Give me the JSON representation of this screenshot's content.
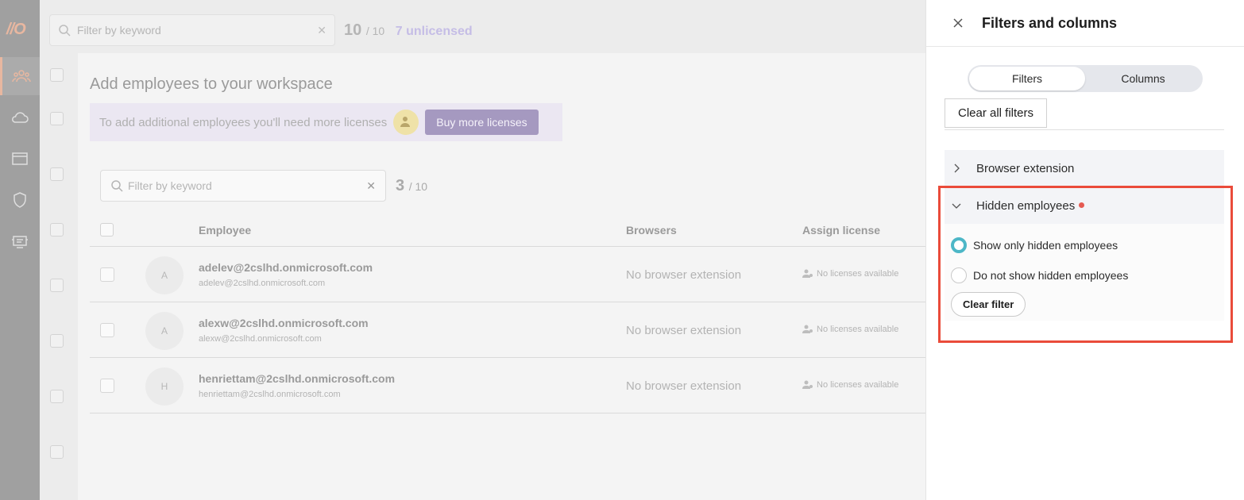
{
  "app": {
    "logo": "//O"
  },
  "nav": [
    {
      "name": "employees-icon",
      "active": true
    },
    {
      "name": "cloud-icon",
      "active": false
    },
    {
      "name": "browser-window-icon",
      "active": false
    },
    {
      "name": "shield-icon",
      "active": false
    },
    {
      "name": "device-icon",
      "active": false
    }
  ],
  "top": {
    "search_placeholder": "Filter by keyword",
    "count": "10",
    "total": "/ 10",
    "unlicensed": "7 unlicensed"
  },
  "modal": {
    "title": "Add employees to your workspace",
    "notice": "To add additional employees you'll need more licenses",
    "buy_label": "Buy more licenses",
    "search_placeholder": "Filter by keyword",
    "count": "3",
    "total": "/ 10",
    "columns": {
      "employee": "Employee",
      "browsers": "Browsers",
      "assign": "Assign license"
    },
    "rows": [
      {
        "initial": "A",
        "email": "adelev@2cslhd.onmicrosoft.com",
        "email_sub": "adelev@2cslhd.onmicrosoft.com",
        "browser": "No browser extension",
        "license": "No licenses available"
      },
      {
        "initial": "A",
        "email": "alexw@2cslhd.onmicrosoft.com",
        "email_sub": "alexw@2cslhd.onmicrosoft.com",
        "browser": "No browser extension",
        "license": "No licenses available"
      },
      {
        "initial": "H",
        "email": "henriettam@2cslhd.onmicrosoft.com",
        "email_sub": "henriettam@2cslhd.onmicrosoft.com",
        "browser": "No browser extension",
        "license": "No licenses available"
      }
    ]
  },
  "drawer": {
    "title": "Filters and columns",
    "tabs": {
      "filters": "Filters",
      "columns": "Columns",
      "active": "Filters"
    },
    "clear_all": "Clear all filters",
    "sections": {
      "browser_extension": {
        "label": "Browser extension",
        "expanded": false
      },
      "hidden_employees": {
        "label": "Hidden employees",
        "expanded": true,
        "options": [
          {
            "label": "Show only hidden employees",
            "selected": true
          },
          {
            "label": "Do not show hidden employees",
            "selected": false
          }
        ],
        "clear_label": "Clear filter"
      }
    }
  },
  "colors": {
    "accent_teal": "#4db7c7",
    "highlight_red": "#ea4b3a",
    "dot_red": "#e55a52"
  }
}
